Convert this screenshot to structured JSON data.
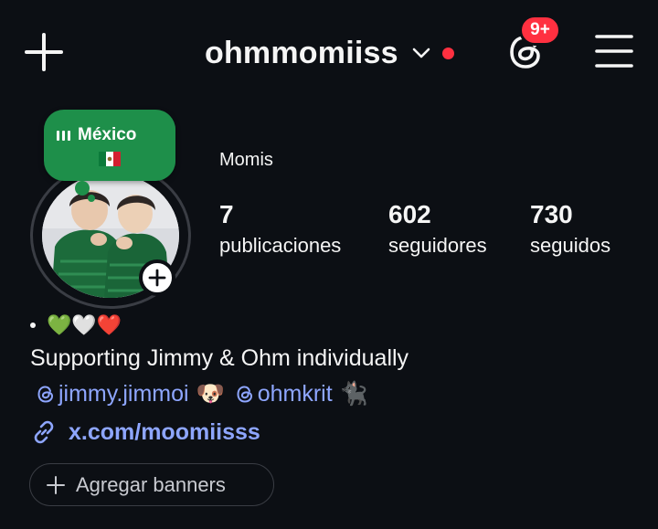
{
  "header": {
    "username": "ohmmomiiss",
    "notifications_badge": "9+",
    "icons": {
      "create": "plus-icon",
      "switch_account": "chevron-down-icon",
      "threads": "threads-icon",
      "menu": "hamburger-menu-icon"
    },
    "colors": {
      "badge": "#ff3040",
      "dot": "#ff3040"
    }
  },
  "note": {
    "text": "México",
    "flag": "mexico-flag-icon",
    "bubble_color": "#1e8f4a"
  },
  "profile": {
    "display_name": "Momis",
    "stats": [
      {
        "value": "7",
        "label": "publicaciones"
      },
      {
        "value": "602",
        "label": "seguidores"
      },
      {
        "value": "730",
        "label": "seguidos"
      }
    ],
    "bio": {
      "emoji_line": "💚🤍❤️",
      "text": "Supporting Jimmy & Ohm individually",
      "mentions": [
        {
          "handle": "jimmy.jimmoi",
          "emoji": "🐶"
        },
        {
          "handle": "ohmkrit",
          "emoji": "🐈‍⬛"
        }
      ]
    },
    "link": "x.com/moomiisss",
    "link_color": "#8ea6ff",
    "add_banners_label": "Agregar banners"
  }
}
